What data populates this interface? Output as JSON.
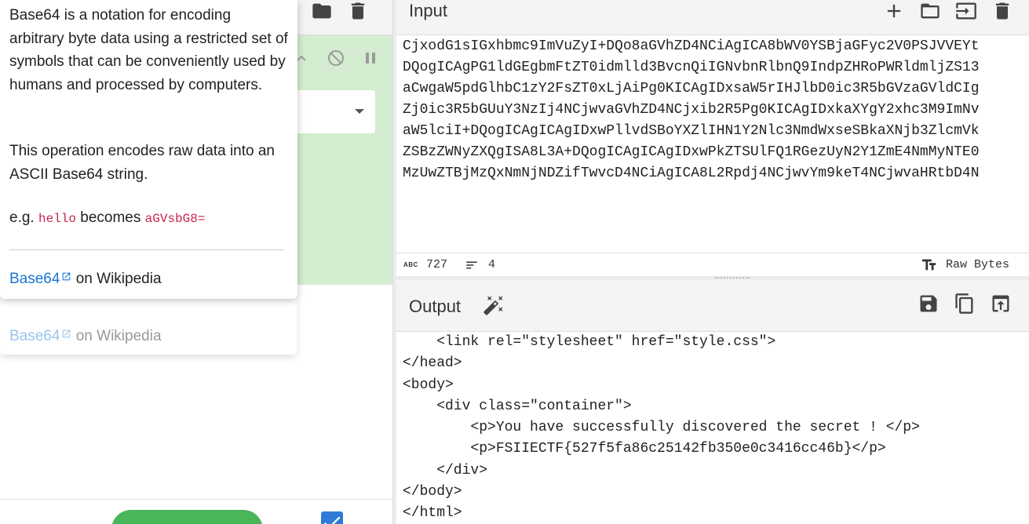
{
  "popover": {
    "description": "Base64 is a notation for encoding arbitrary byte data using a restricted set of symbols that can be conveniently used by humans and processed by computers.",
    "operation_note": "This operation encodes raw data into an ASCII Base64 string.",
    "example_prefix": "e.g.",
    "example_input": "hello",
    "example_mid": "becomes",
    "example_output": "aGVsbG8=",
    "wiki_link": "Base64",
    "wiki_suffix": "on Wikipedia"
  },
  "ghost_popover": {
    "wiki_link": "Base64",
    "wiki_suffix": "on Wikipedia"
  },
  "input": {
    "title": "Input",
    "lines": [
      "CjxodG1sIGxhbmc9ImVuZyI+DQo8aGVhZD4NCiAgICA8bWV0YSBjaGFyc2V0PSJVVEYt",
      "DQogICAgPG1ldGEgbmFtZT0idmlld3BvcnQiIGNvbnRlbnQ9IndpZHRoPWRldmljZS13",
      "aCwgaW5pdGlhbC1zY2FsZT0xLjAiPg0KICAgIDxsaW5rIHJlbD0ic3R5bGVzaGVldCIg",
      "Zj0ic3R5bGUuY3NzIj4NCjwvaGVhZD4NCjxib2R5Pg0KICAgIDxkaXYgY2xhc3M9ImNv",
      "aW5lciI+DQogICAgICAgIDxwPllvdSBoYXZlIHN1Y2Nlc3NmdWxseSBkaXNjb3ZlcmVk",
      "ZSBzZWNyZXQgISA8L3A+DQogICAgICAgIDxwPkZTSUlFQ1RGezUyN2Y1ZmE4NmMyNTE0",
      "MzUwZTBjMzQxNmNjNDZifTwvcD4NCiAgICA8L2Rpdj4NCjwvYm9keT4NCjwvaHRtbD4N"
    ],
    "length": "727",
    "line_count": "4",
    "encoding": "Raw Bytes"
  },
  "output": {
    "title": "Output",
    "lines": [
      "    <link rel=\"stylesheet\" href=\"style.css\">",
      "</head>",
      "<body>",
      "    <div class=\"container\">",
      "        <p>You have successfully discovered the secret ! </p>",
      "        <p>FSIIECTF{527f5fa86c25142fb350e0c3416cc46b}</p>",
      "    </div>",
      "</body>",
      "</html>"
    ]
  },
  "icons": {
    "recipe_header": [
      "save-icon",
      "folder-icon",
      "trash-icon"
    ],
    "input_header": [
      "plus-icon",
      "folder-icon",
      "import-icon",
      "trash-icon"
    ],
    "output_header": [
      "save-icon",
      "copy-icon",
      "open-in-input-icon"
    ],
    "magic": "magic-wand-icon"
  },
  "colors": {
    "operation_bg": "#d4ecd0",
    "link": "#1976d2",
    "code": "#c7254e",
    "bake": "#4bb55a",
    "checkbox": "#2e7bd6"
  }
}
